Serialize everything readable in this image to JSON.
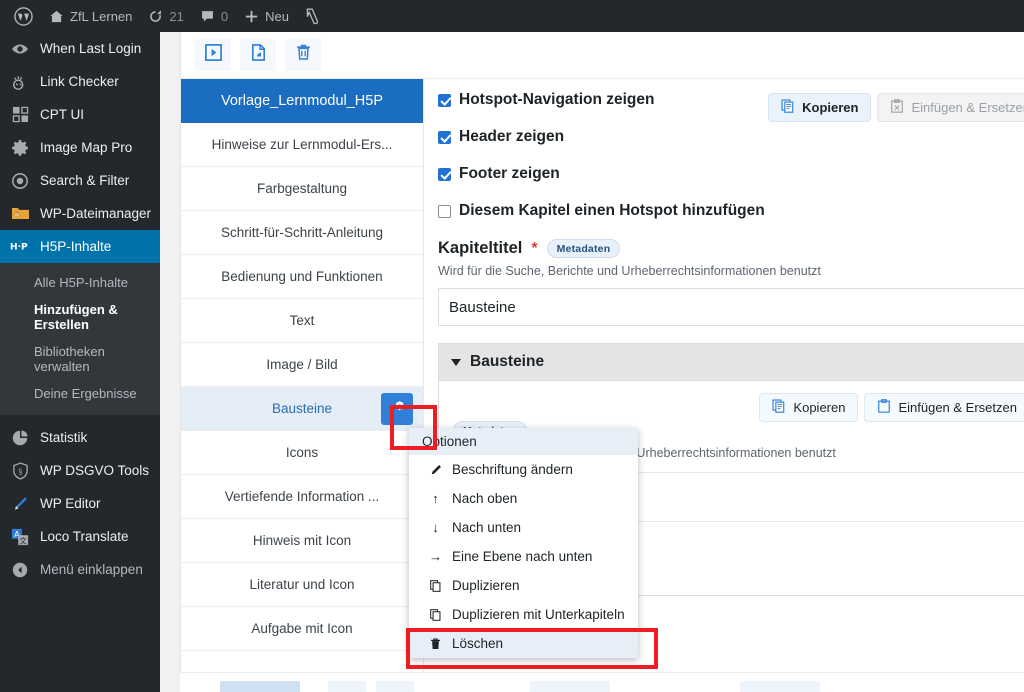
{
  "adminbar": {
    "wp_logo_icon": "wordpress-logo-icon",
    "site_icon": "home-icon",
    "site_name": "ZfL Lernen",
    "updates_icon": "updates-icon",
    "updates_count": "21",
    "comments_icon": "comment-bubble-icon",
    "comments_count": "0",
    "new_icon": "plus-icon",
    "new_label": "Neu",
    "yoast_icon": "yoast-seo-icon"
  },
  "sidebar": {
    "items": [
      {
        "label": "When Last Login",
        "icon": "eye-icon",
        "state": "normal"
      },
      {
        "label": "Link Checker",
        "icon": "link-checker-icon",
        "state": "normal"
      },
      {
        "label": "CPT UI",
        "icon": "cpt-ui-grid-icon",
        "state": "normal"
      },
      {
        "label": "Image Map Pro",
        "icon": "gear-icon",
        "state": "normal"
      },
      {
        "label": "Search & Filter",
        "icon": "target-circle-icon",
        "state": "normal"
      },
      {
        "label": "WP-Dateimanager",
        "icon": "folder-icon",
        "state": "normal"
      },
      {
        "label": "H5P-Inhalte",
        "icon": "h5p-icon",
        "state": "current"
      }
    ],
    "submenu": [
      {
        "label": "Alle H5P-Inhalte",
        "active": false
      },
      {
        "label": "Hinzufügen & Erstellen",
        "active": true
      },
      {
        "label": "Bibliotheken verwalten",
        "active": false
      },
      {
        "label": "Deine Ergebnisse",
        "active": false
      }
    ],
    "items_after": [
      {
        "label": "Statistik",
        "icon": "pie-chart-icon",
        "state": "normal"
      },
      {
        "label": "WP DSGVO Tools",
        "icon": "shield-icon",
        "state": "normal"
      },
      {
        "label": "WP Editor",
        "icon": "pencil-icon",
        "state": "normal"
      },
      {
        "label": "Loco Translate",
        "icon": "translate-icon",
        "state": "normal"
      }
    ],
    "collapse": {
      "label": "Menü einklappen",
      "icon": "collapse-arrow-icon"
    }
  },
  "toolbar": {
    "buttons": [
      {
        "icon": "preview-play-icon",
        "name": "preview-button"
      },
      {
        "icon": "export-file-icon",
        "name": "export-button"
      },
      {
        "icon": "trash-icon",
        "name": "delete-button"
      }
    ]
  },
  "chapters": [
    {
      "label": "Vorlage_Lernmodul_H5P",
      "state": "root",
      "has_options": false
    },
    {
      "label": "Hinweise zur Lernmodul-Ers...",
      "state": "normal",
      "has_options": false
    },
    {
      "label": "Farbgestaltung",
      "state": "normal",
      "has_options": false
    },
    {
      "label": "Schritt-für-Schritt-Anleitung",
      "state": "normal",
      "has_options": false
    },
    {
      "label": "Bedienung und Funktionen",
      "state": "normal",
      "has_options": false
    },
    {
      "label": "Text",
      "state": "normal",
      "has_options": false
    },
    {
      "label": "Image / Bild",
      "state": "normal",
      "has_options": false
    },
    {
      "label": "Bausteine",
      "state": "selected",
      "has_options": true,
      "options_icon": "options-gear-icon"
    },
    {
      "label": "Icons",
      "state": "normal",
      "has_options": false
    },
    {
      "label": "Vertiefende Information ...",
      "state": "normal",
      "has_options": false
    },
    {
      "label": "Hinweis mit Icon",
      "state": "normal",
      "has_options": false
    },
    {
      "label": "Literatur und Icon",
      "state": "normal",
      "has_options": false
    },
    {
      "label": "Aufgabe mit Icon",
      "state": "normal",
      "has_options": false
    }
  ],
  "form": {
    "checkboxes": [
      {
        "label": "Hotspot-Navigation zeigen",
        "checked": true
      },
      {
        "label": "Header zeigen",
        "checked": true
      },
      {
        "label": "Footer zeigen",
        "checked": true
      },
      {
        "label": "Diesem Kapitel einen Hotspot hinzufügen",
        "checked": false
      }
    ],
    "title_field": {
      "label": "Kapiteltitel",
      "required_mark": "*",
      "metadata_badge": "Metadaten",
      "description": "Wird für die Suche, Berichte und Urheberrechtsinformationen benutzt",
      "value": "Bausteine",
      "copy_label": "Kopieren",
      "copy_icon": "copy-icon",
      "paste_label": "Einfügen & Ersetzen",
      "paste_icon": "paste-icon"
    },
    "group": {
      "title": "Bausteine",
      "collapse_icon": "triangle-down-icon",
      "copy_label": "Kopieren",
      "copy_icon": "copy-icon",
      "paste_label": "Einfügen & Ersetzen",
      "paste_icon": "paste-icon",
      "metadata_badge": "Metadaten",
      "description": "Wird für die Suche, Berichte und Urheberrechtsinformationen benutzt",
      "note_tail": "tzt."
    }
  },
  "context_menu": {
    "title": "Optionen",
    "items": [
      {
        "label": "Beschriftung ändern",
        "icon": "pencil-icon",
        "glyph": "✏",
        "highlight": false
      },
      {
        "label": "Nach oben",
        "icon": "arrow-up-icon",
        "glyph": "↑",
        "highlight": false
      },
      {
        "label": "Nach unten",
        "icon": "arrow-down-icon",
        "glyph": "↓",
        "highlight": false
      },
      {
        "label": "Eine Ebene nach unten",
        "icon": "arrow-right-icon",
        "glyph": "→",
        "highlight": false
      },
      {
        "label": "Duplizieren",
        "icon": "duplicate-icon",
        "glyph": "❐",
        "highlight": false
      },
      {
        "label": "Duplizieren mit Unterkapiteln",
        "icon": "duplicate-icon",
        "glyph": "❐",
        "highlight": false
      },
      {
        "label": "Löschen",
        "icon": "trash-icon",
        "glyph": "🗑",
        "highlight": true
      }
    ]
  },
  "colors": {
    "wp_admin_dark": "#23282d",
    "wp_admin_submenu": "#32373c",
    "wp_current_blue": "#0073aa",
    "chapter_root_blue": "#1a6dc0",
    "chapter_selected_bg": "#e5edf7",
    "options_button_blue": "#2f80d6",
    "annotation_red": "#ee1c23",
    "checkbox_blue": "#2271d6"
  }
}
